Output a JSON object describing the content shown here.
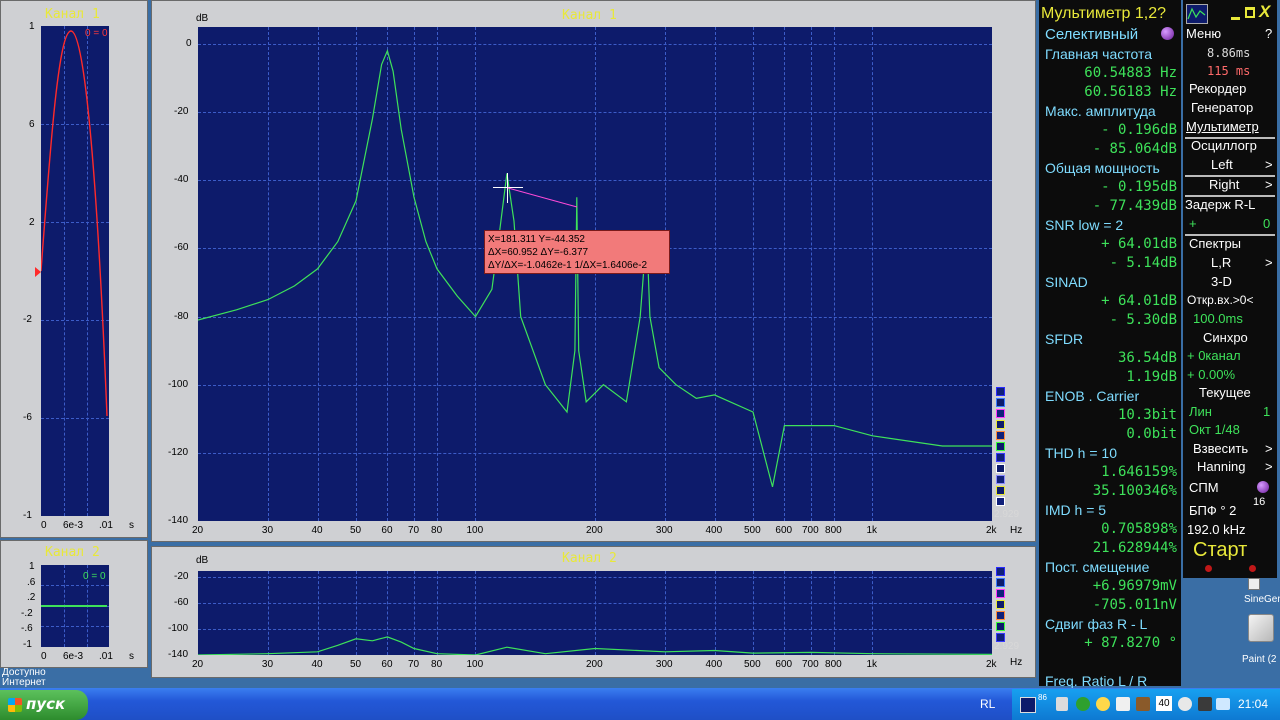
{
  "left_ch1": {
    "title": "Канал 1",
    "yticks": [
      "1",
      "6",
      "2",
      "-2",
      "-6",
      "-1"
    ],
    "xticks": [
      "0",
      "6e-3",
      ".01",
      "s"
    ],
    "zero_label": "0 = 0"
  },
  "left_ch2": {
    "title": "Канал 2",
    "yticks": [
      "1",
      ".6",
      ".2",
      "-.2",
      "-.6",
      "-1"
    ],
    "xticks": [
      "0",
      "6e-3",
      ".01",
      "s"
    ],
    "zero_label": "0 = 0"
  },
  "main_ch1": {
    "title": "Канал 1",
    "y_unit": "dB",
    "x_unit": "Hz",
    "yticks": [
      "0",
      "-20",
      "-40",
      "-60",
      "-80",
      "-100",
      "-120",
      "-140"
    ],
    "xticks": [
      "20",
      "30",
      "40",
      "50",
      "60",
      "70",
      "80",
      "100",
      "200",
      "300",
      "400",
      "500",
      "600",
      "700",
      "800",
      "1k",
      "2k"
    ],
    "corner_value": "2.929",
    "cursor": {
      "line1": "X=181.311   Y=-44.352",
      "line2": "ΔX=60.952  ΔY=-6.377",
      "line3": "ΔY/ΔX=-1.0462e-1  1/ΔX=1.6406e-2"
    }
  },
  "main_ch2": {
    "title": "Канал 2",
    "y_unit": "dB",
    "x_unit": "Hz",
    "yticks": [
      "-20",
      "-60",
      "-100",
      "-140"
    ],
    "xticks": [
      "20",
      "30",
      "40",
      "50",
      "60",
      "70",
      "80",
      "100",
      "200",
      "300",
      "400",
      "500",
      "600",
      "700",
      "800",
      "1k",
      "2k"
    ],
    "corner_value": "2.929"
  },
  "chart_data": [
    {
      "type": "line",
      "title": "Канал 1",
      "ylabel": "dB",
      "xlabel": "Hz",
      "x_scale": "log",
      "xlim": [
        20,
        2000
      ],
      "ylim": [
        -140,
        5
      ],
      "grid": true,
      "series": [
        {
          "color": "#3ee25a",
          "x": [
            20,
            25,
            30,
            35,
            40,
            45,
            50,
            55,
            58,
            60,
            62,
            65,
            70,
            75,
            80,
            90,
            100,
            110,
            115,
            120,
            125,
            130,
            150,
            170,
            178,
            180,
            182,
            190,
            210,
            240,
            260,
            270,
            275,
            290,
            320,
            360,
            400,
            500,
            560,
            600,
            800,
            1000,
            1500,
            2000
          ],
          "y": [
            -81,
            -78,
            -75,
            -71,
            -66,
            -58,
            -46,
            -22,
            -6,
            -2,
            -8,
            -25,
            -45,
            -58,
            -66,
            -74,
            -80,
            -72,
            -55,
            -38,
            -52,
            -80,
            -100,
            -108,
            -90,
            -45,
            -90,
            -105,
            -100,
            -105,
            -80,
            -55,
            -80,
            -95,
            -100,
            -104,
            -103,
            -108,
            -130,
            -112,
            -112,
            -115,
            -118,
            -118
          ]
        }
      ]
    },
    {
      "type": "line",
      "title": "Канал 2",
      "ylabel": "dB",
      "xlabel": "Hz",
      "x_scale": "log",
      "xlim": [
        20,
        2000
      ],
      "ylim": [
        -140,
        -10
      ],
      "grid": true,
      "series": [
        {
          "color": "#3ee25a",
          "x": [
            20,
            30,
            40,
            45,
            50,
            55,
            60,
            65,
            70,
            80,
            100,
            120,
            150,
            200,
            300,
            400,
            500,
            700,
            1000,
            2000
          ],
          "y": [
            -140,
            -138,
            -135,
            -125,
            -115,
            -118,
            -112,
            -120,
            -130,
            -138,
            -140,
            -128,
            -138,
            -130,
            -135,
            -133,
            -137,
            -136,
            -138,
            -139
          ]
        }
      ]
    }
  ],
  "meter": {
    "title": "Мультиметр 1,2?",
    "mode": "Селективный",
    "rows": [
      {
        "label": "Главная частота",
        "v1": "60.54883  Hz",
        "v2": "60.56183  Hz"
      },
      {
        "label": "Макс. амплитуда",
        "v1": "-  0.196dB",
        "v2": "-  85.064dB"
      },
      {
        "label": "Общая мощность",
        "v1": "-  0.195dB",
        "v2": "-  77.439dB"
      },
      {
        "label": "SNR      low =   2",
        "v1": "+  64.01dB",
        "v2": "-   5.14dB"
      },
      {
        "label": "SINAD",
        "v1": "+  64.01dB",
        "v2": "-   5.30dB"
      },
      {
        "label": "SFDR",
        "v1": "36.54dB",
        "v2": "1.19dB"
      },
      {
        "label": "ENOB . Carrier",
        "v1": "10.3bit",
        "v2": "0.0bit"
      },
      {
        "label": "THD        h =   10",
        "v1": "1.646159%",
        "v2": "35.100346%"
      },
      {
        "label": "IMD        h =    5",
        "v1": "0.705898%",
        "v2": "21.628944%"
      },
      {
        "label": "Пост. смещение",
        "v1": "+6.96979mV",
        "v2": "-705.011nV"
      },
      {
        "label": "Сдвиг фаз R - L",
        "v1": "+ 87.8270 °",
        "v2": ""
      },
      {
        "label": "Freq. Ratio  L / R",
        "v1": "",
        "v2": ""
      }
    ]
  },
  "menu": {
    "header": "Меню",
    "help": "?",
    "time1": "8.86ms",
    "time2": "115 ms",
    "recorder": "Рекордер",
    "generator": "Генератор",
    "multimeter": "Мультиметр",
    "oscillograph": "Осциллогр",
    "left": "Left",
    "right": "Right",
    "delay": "Задерж R-L",
    "delay_plus": "+",
    "delay_val": "0",
    "spectra": "Спектры",
    "lr": "L,R",
    "threed": "3-D",
    "open": "Откр.вх.>0<",
    "open_val": "100.0ms",
    "sync": "Синхро",
    "sync_ch": "+  0канал",
    "sync_pct": "+  0.00%",
    "current": "Текущее",
    "lin": "Лин",
    "lin_val": "1",
    "oct": "Окт  1/48",
    "weigh": "Взвесить",
    "hanning": "Hanning",
    "spm": "СПМ",
    "fft": "БПФ ° 2",
    "fft_exp": "16",
    "rate": "192.0 kHz",
    "start": "Старт",
    "arrow": ">"
  },
  "desktop": {
    "icon1": "SineGen",
    "icon2": "Paint (2",
    "left_text1": "Доступно",
    "left_text2": "Интернет"
  },
  "taskbar": {
    "start": "пуск",
    "lang": "RL",
    "clock": "21:04",
    "tray_num": "40",
    "tray_small": "86"
  }
}
